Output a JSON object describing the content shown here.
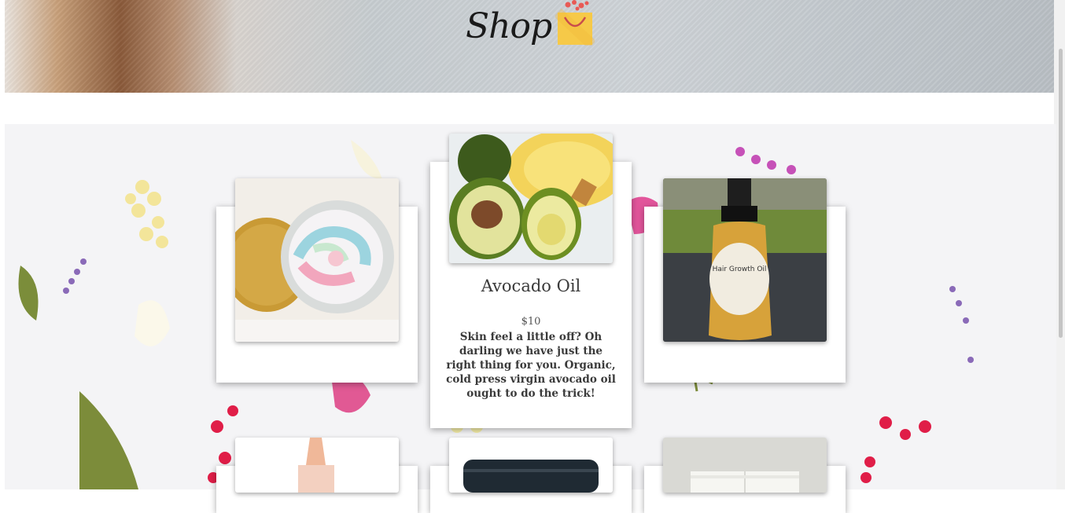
{
  "header": {
    "title": "Shop",
    "icon": "shopping-bag-icon"
  },
  "products": [
    {
      "name": "",
      "image": "whipped-body-butter-jar"
    },
    {
      "name": "Avocado Oil",
      "price": "$10",
      "description": "Skin feel a little off? Oh darling we have just the right thing for you. Organic, cold press virgin avocado oil ought to do the trick!",
      "image": "avocado-oil"
    },
    {
      "name": "",
      "image": "hair-growth-oil-bottle"
    },
    {
      "name": "",
      "image": "oil-dropper-bottle"
    },
    {
      "name": "",
      "image": "black-lid-jar"
    },
    {
      "name": "",
      "image": "white-cap-bottles"
    }
  ],
  "colors": {
    "accent_bag": "#f6c948",
    "hearts": "#e85a55"
  }
}
